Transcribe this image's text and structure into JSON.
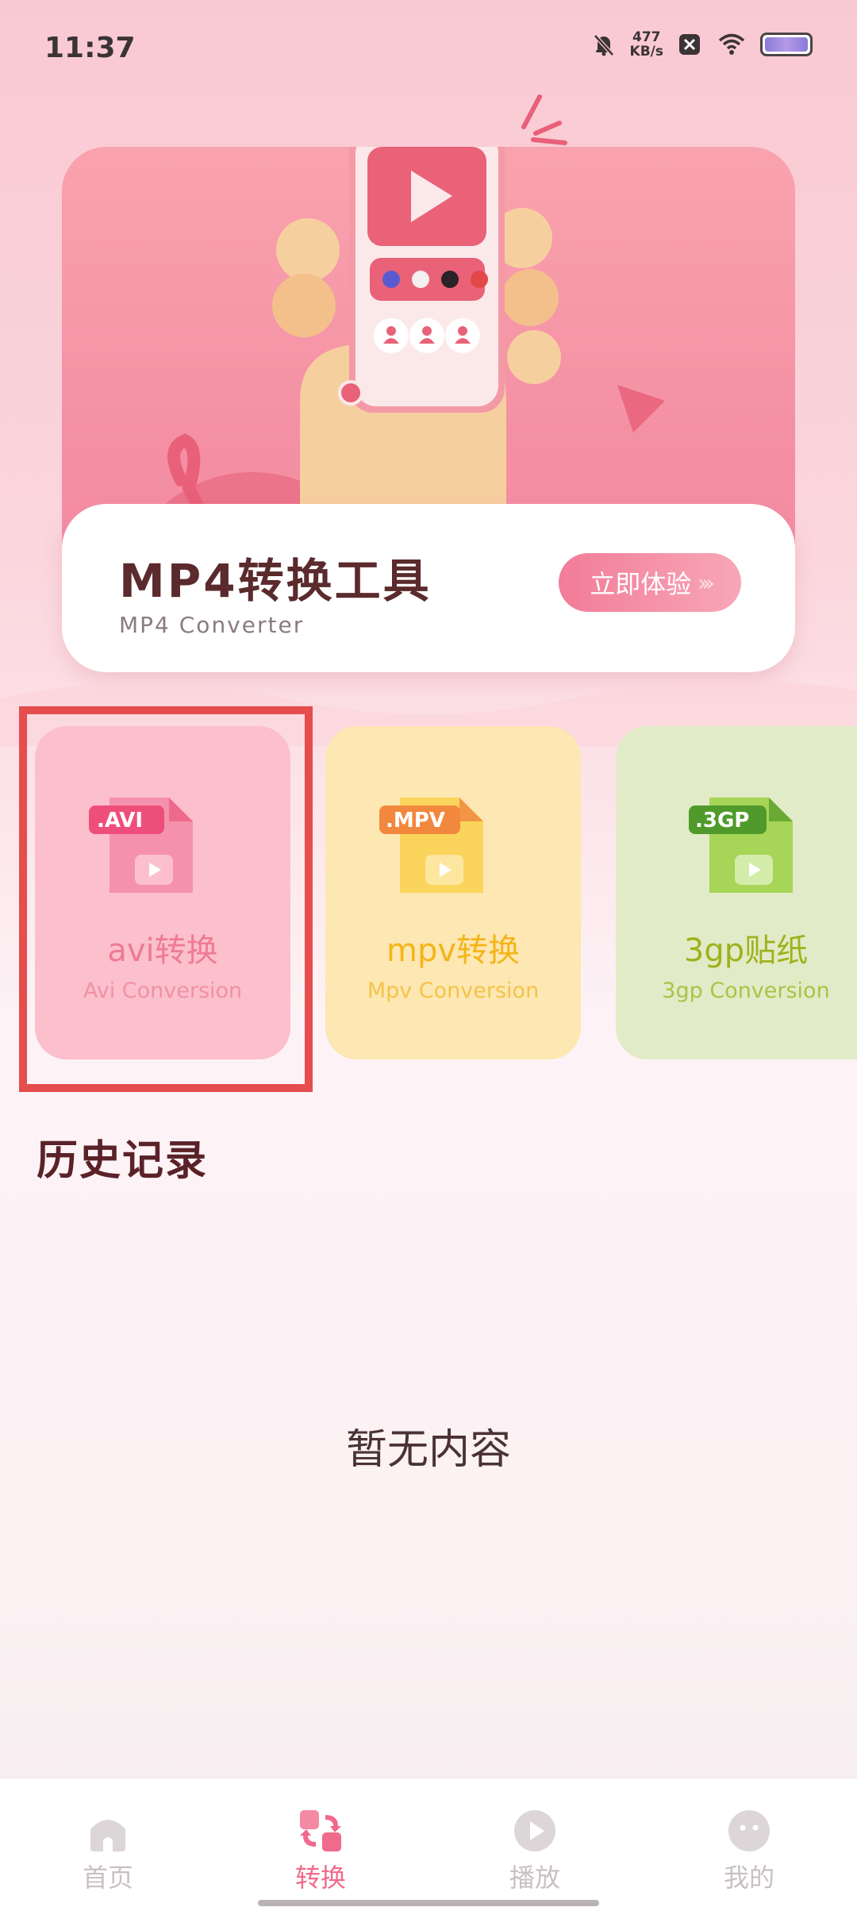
{
  "status_bar": {
    "time": "11:37",
    "speed_value": "477",
    "speed_unit": "KB/s"
  },
  "banner": {
    "title": "MP4转换工具",
    "subtitle": "MP4 Converter",
    "button_label": "立即体验",
    "button_arrows": "›››"
  },
  "cards": [
    {
      "badge": ".AVI",
      "title": "avi转换",
      "subtitle": "Avi Conversion",
      "accent": "#f07b95"
    },
    {
      "badge": ".MPV",
      "title": "mpv转换",
      "subtitle": "Mpv Conversion",
      "accent": "#f5b92b"
    },
    {
      "badge": ".3GP",
      "title": "3gp贴纸",
      "subtitle": "3gp Conversion",
      "accent": "#9ccc3a"
    }
  ],
  "history": {
    "title": "历史记录",
    "empty_text": "暂无内容"
  },
  "tabs": [
    {
      "label": "首页",
      "icon": "home-icon",
      "active": false
    },
    {
      "label": "转换",
      "icon": "convert-icon",
      "active": true
    },
    {
      "label": "播放",
      "icon": "play-icon",
      "active": false
    },
    {
      "label": "我的",
      "icon": "profile-icon",
      "active": false
    }
  ]
}
